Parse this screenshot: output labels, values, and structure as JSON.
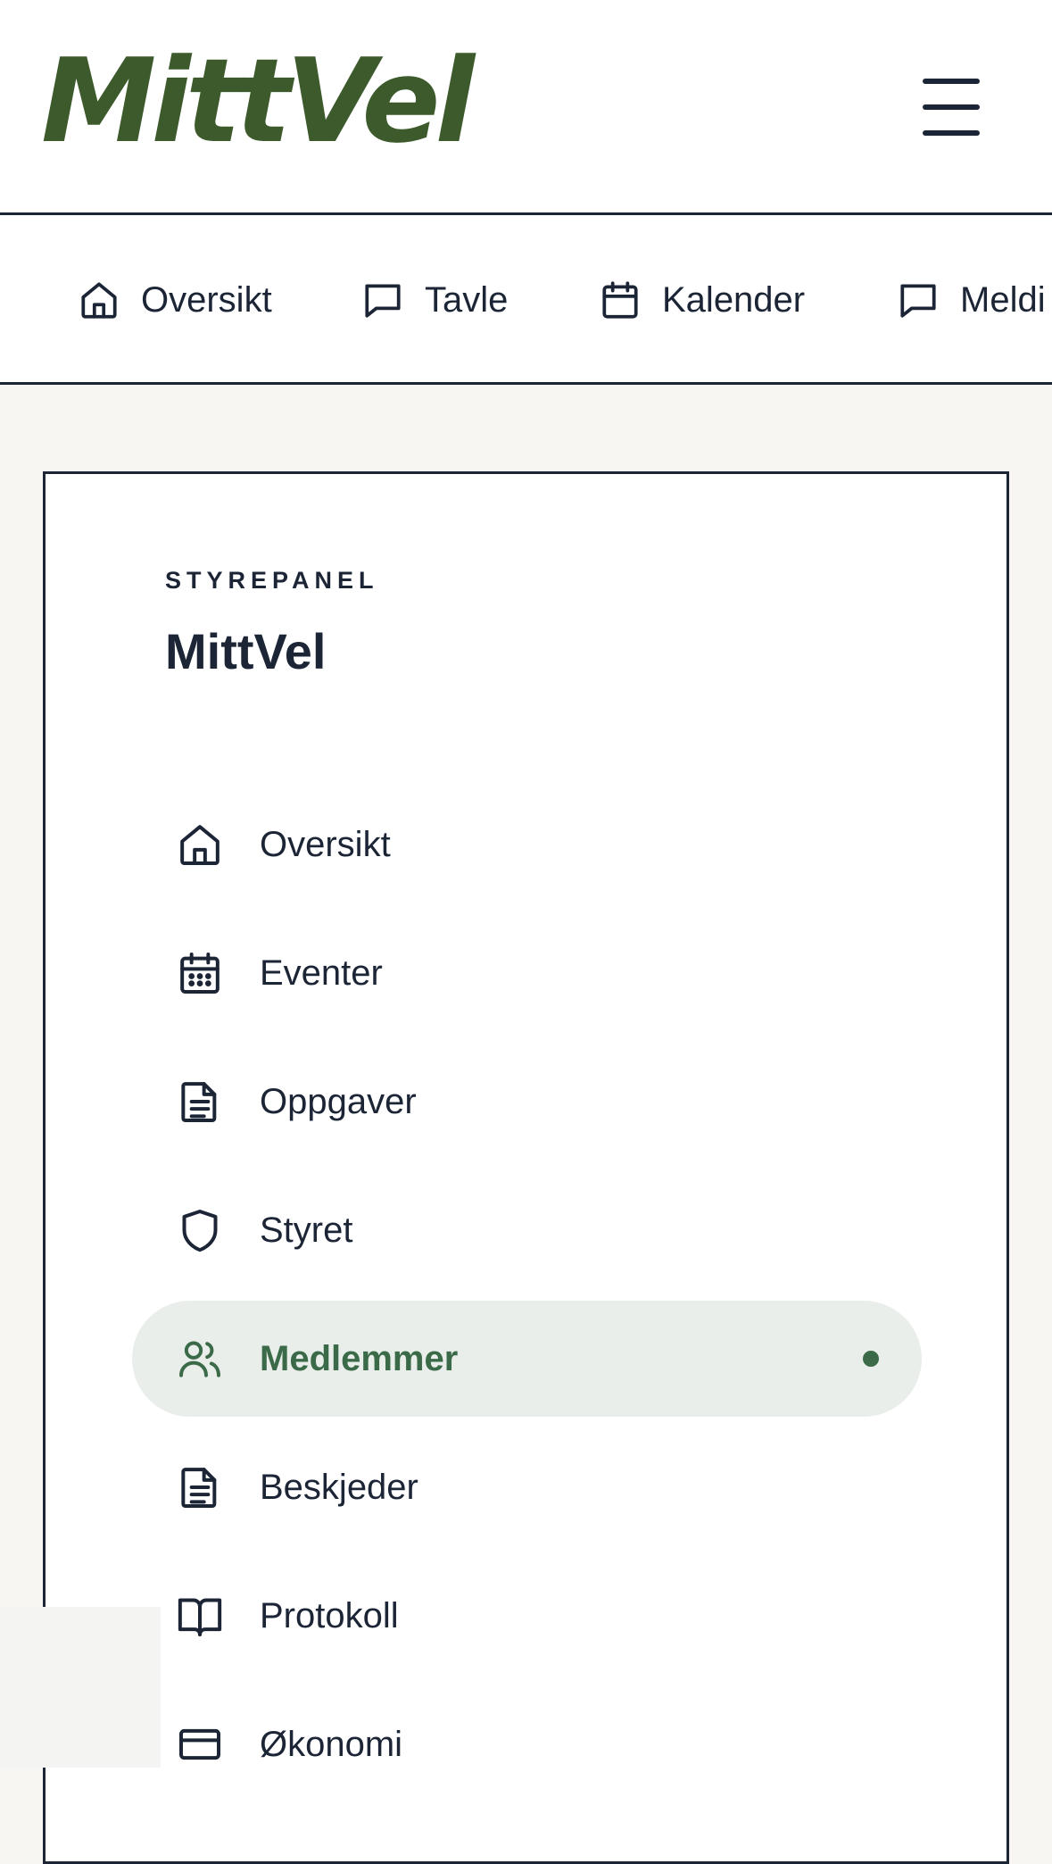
{
  "header": {
    "logo_text": "MittVel",
    "menu_icon": "hamburger-menu-icon",
    "brand_color": "#3c5a2c"
  },
  "tabs": [
    {
      "label": "Oversikt",
      "icon": "home-icon"
    },
    {
      "label": "Tavle",
      "icon": "message-square-icon"
    },
    {
      "label": "Kalender",
      "icon": "calendar-icon"
    },
    {
      "label": "Meldi",
      "icon": "message-square-icon"
    }
  ],
  "panel": {
    "eyebrow": "STYREPANEL",
    "title": "MittVel",
    "accent_color": "#3a6a48",
    "items": [
      {
        "label": "Oversikt",
        "icon": "home-icon",
        "active": false
      },
      {
        "label": "Eventer",
        "icon": "calendar-grid-icon",
        "active": false
      },
      {
        "label": "Oppgaver",
        "icon": "document-icon",
        "active": false
      },
      {
        "label": "Styret",
        "icon": "shield-icon",
        "active": false
      },
      {
        "label": "Medlemmer",
        "icon": "users-icon",
        "active": true
      },
      {
        "label": "Beskjeder",
        "icon": "document-icon",
        "active": false
      },
      {
        "label": "Protokoll",
        "icon": "book-open-icon",
        "active": false
      },
      {
        "label": "Økonomi",
        "icon": "credit-card-icon",
        "active": false
      }
    ]
  }
}
